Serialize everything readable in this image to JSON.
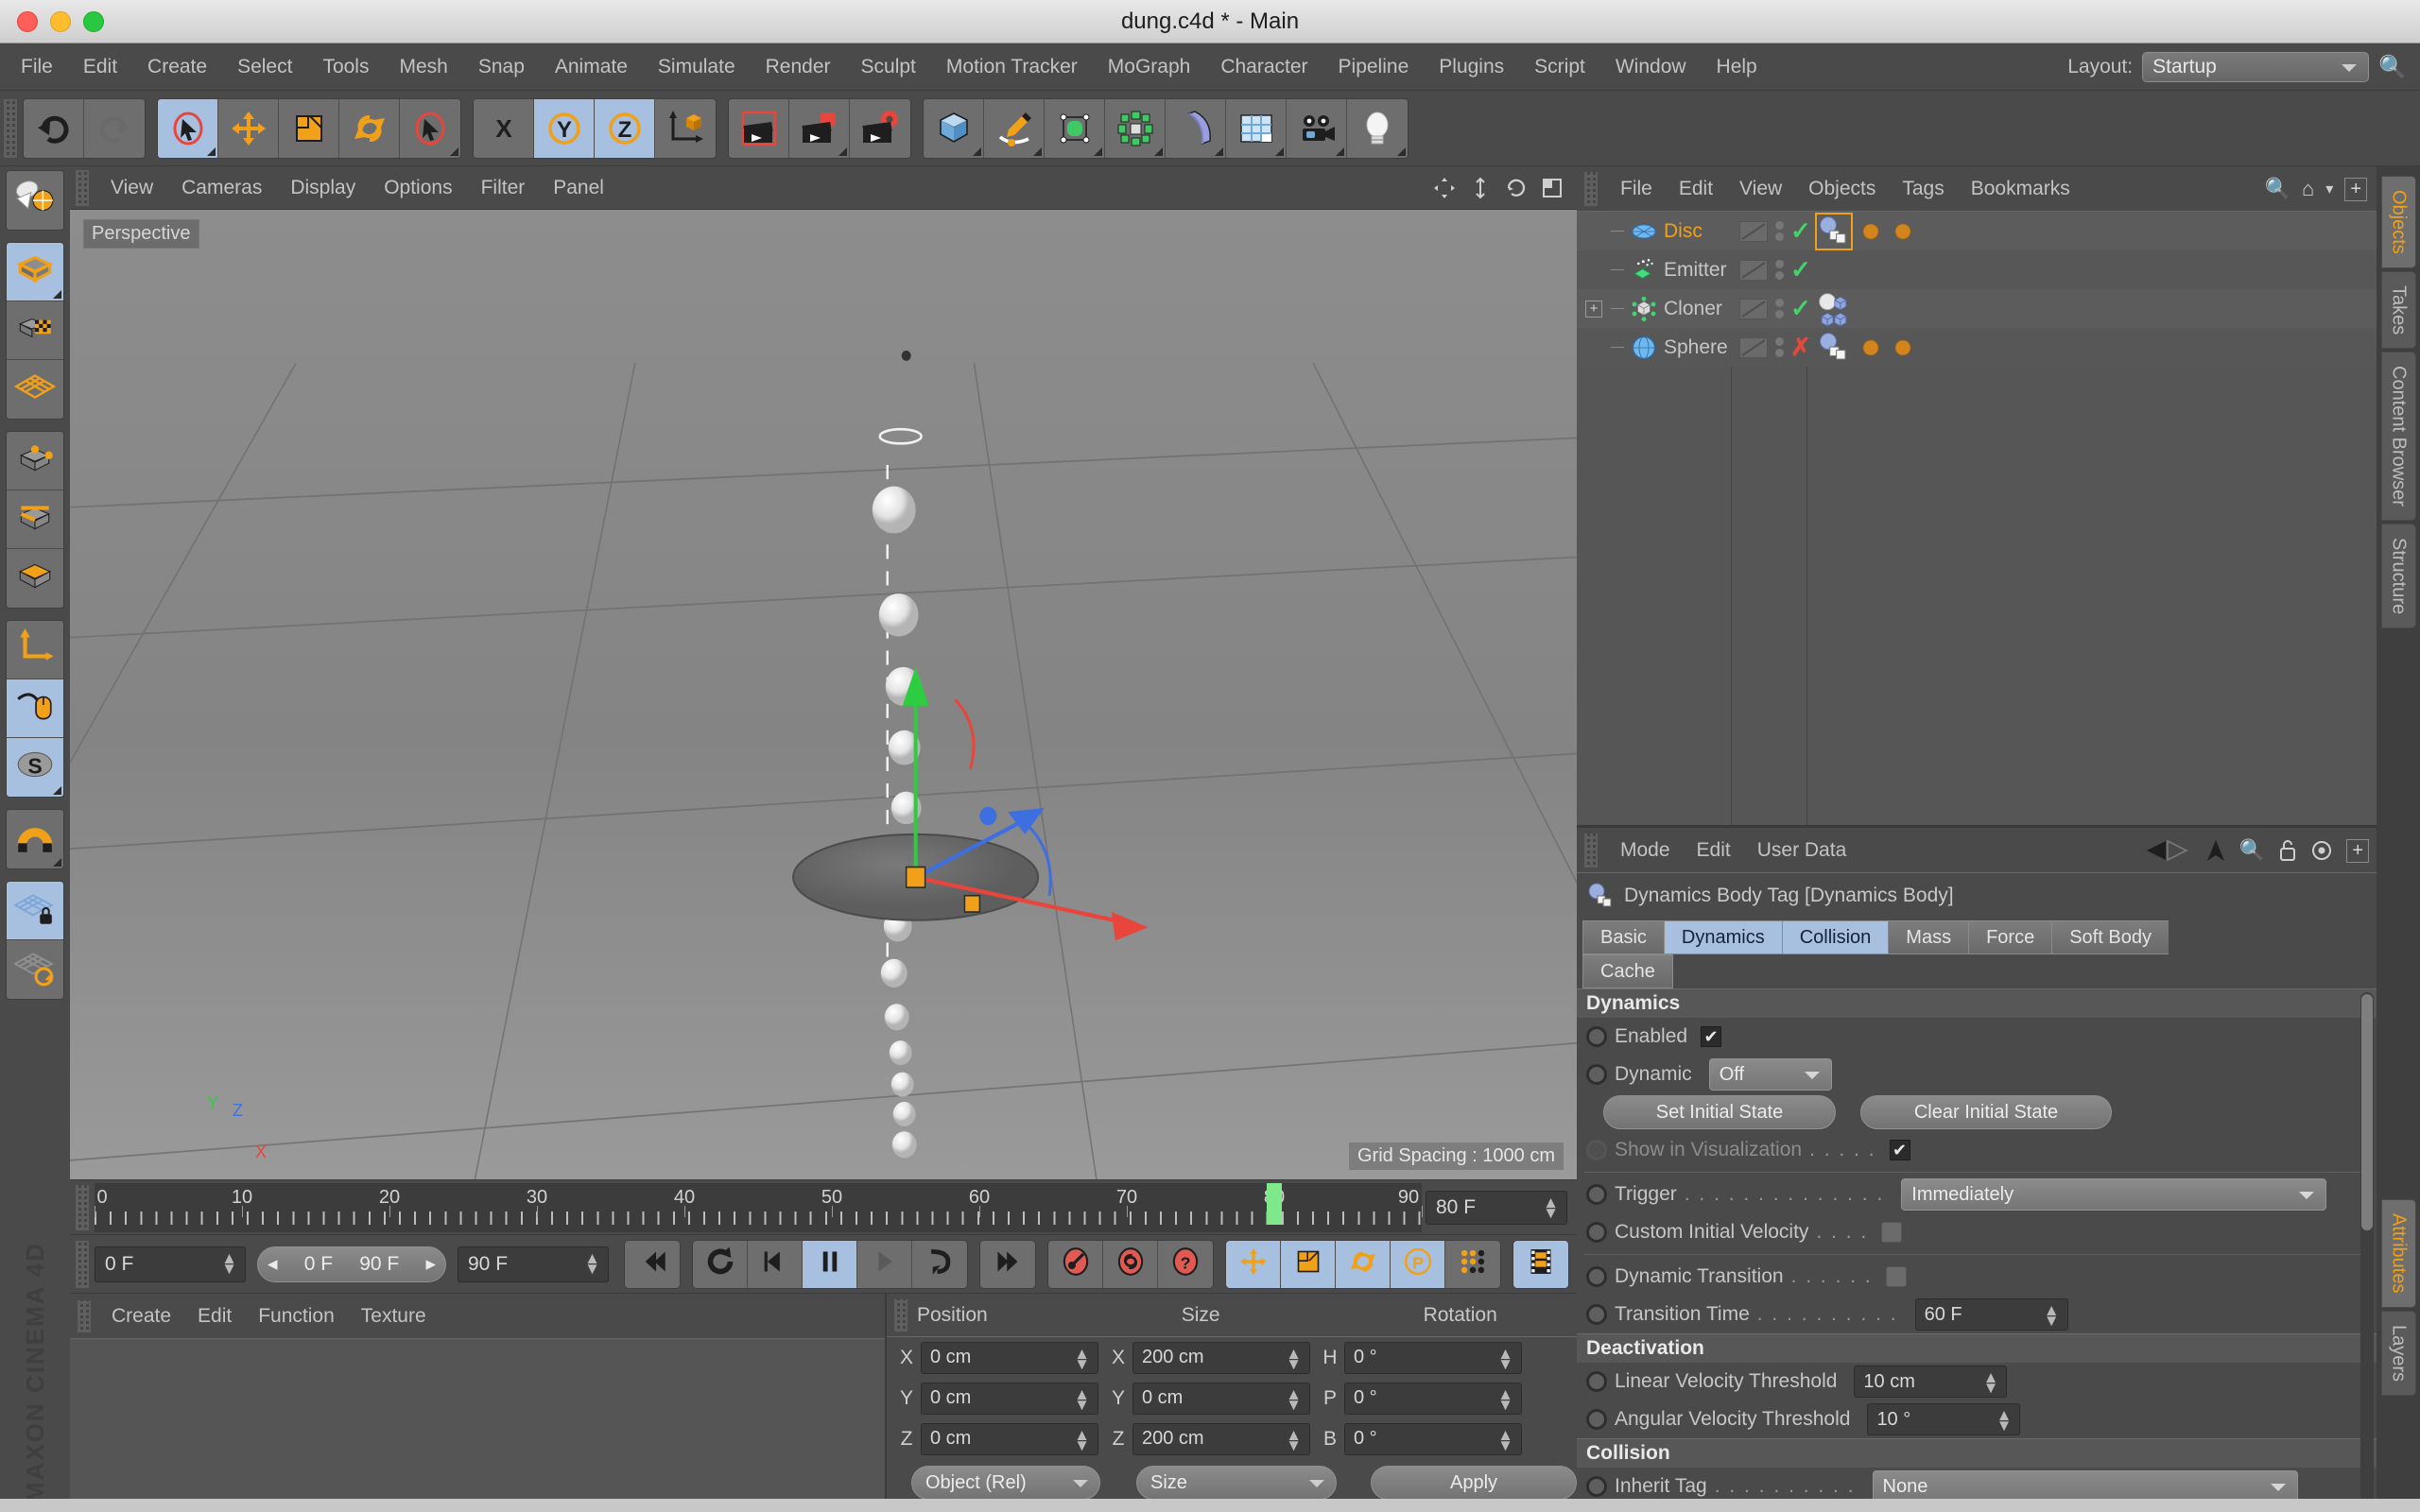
{
  "window": {
    "title": "dung.c4d * - Main"
  },
  "menubar": {
    "items": [
      "File",
      "Edit",
      "Create",
      "Select",
      "Tools",
      "Mesh",
      "Snap",
      "Animate",
      "Simulate",
      "Render",
      "Sculpt",
      "Motion Tracker",
      "MoGraph",
      "Character",
      "Pipeline",
      "Plugins",
      "Script",
      "Window",
      "Help"
    ],
    "layout_label": "Layout:",
    "layout_value": "Startup",
    "search_icon": "search-icon"
  },
  "toolbar": {
    "groups": [
      {
        "buttons": [
          {
            "icon": "undo-icon",
            "active": false,
            "corner": false
          },
          {
            "icon": "redo-icon",
            "active": false,
            "corner": false
          }
        ]
      },
      {
        "buttons": [
          {
            "icon": "live-selection-icon",
            "active": true,
            "corner": true
          },
          {
            "icon": "move-icon",
            "active": false,
            "corner": false
          },
          {
            "icon": "scale-icon",
            "active": false,
            "corner": false
          },
          {
            "icon": "rotate-icon",
            "active": false,
            "corner": false
          },
          {
            "icon": "selection-cursor-icon",
            "active": false,
            "corner": true
          }
        ]
      },
      {
        "buttons": [
          {
            "icon": "axis-x-icon",
            "active": false,
            "corner": false
          },
          {
            "icon": "axis-y-icon",
            "active": true,
            "corner": false
          },
          {
            "icon": "axis-z-icon",
            "active": true,
            "corner": false
          },
          {
            "icon": "world-object-axis-icon",
            "active": false,
            "corner": false
          }
        ]
      },
      {
        "buttons": [
          {
            "icon": "render-view-icon",
            "active": false,
            "corner": false
          },
          {
            "icon": "render-region-icon",
            "active": false,
            "corner": true
          },
          {
            "icon": "render-settings-icon",
            "active": false,
            "corner": false
          }
        ]
      },
      {
        "buttons": [
          {
            "icon": "cube-primitive-icon",
            "active": false,
            "corner": true
          },
          {
            "icon": "spline-pen-icon",
            "active": false,
            "corner": true
          },
          {
            "icon": "nurbs-generator-icon",
            "active": false,
            "corner": true
          },
          {
            "icon": "array-modeling-icon",
            "active": false,
            "corner": true
          },
          {
            "icon": "deformer-bend-icon",
            "active": false,
            "corner": true
          },
          {
            "icon": "scene-environment-icon",
            "active": false,
            "corner": true
          },
          {
            "icon": "camera-icon",
            "active": false,
            "corner": true
          },
          {
            "icon": "light-icon",
            "active": false,
            "corner": true
          }
        ]
      }
    ]
  },
  "lefttools": {
    "groups": [
      {
        "buttons": [
          {
            "icon": "undo-view-icon",
            "active": false,
            "corner": false
          }
        ]
      },
      {
        "buttons": [
          {
            "icon": "model-mode-icon",
            "active": true,
            "corner": true
          },
          {
            "icon": "texture-mode-icon",
            "active": false,
            "corner": false
          },
          {
            "icon": "workplane-mode-icon",
            "active": false,
            "corner": false
          }
        ]
      },
      {
        "buttons": [
          {
            "icon": "points-mode-icon",
            "active": false,
            "corner": false
          },
          {
            "icon": "edges-mode-icon",
            "active": false,
            "corner": false
          },
          {
            "icon": "polygons-mode-icon",
            "active": false,
            "corner": false
          }
        ]
      },
      {
        "buttons": [
          {
            "icon": "object-axis-icon",
            "active": false,
            "corner": false
          },
          {
            "icon": "enable-axis-icon",
            "active": true,
            "corner": false
          },
          {
            "icon": "soft-selection-icon",
            "active": true,
            "corner": true
          }
        ]
      },
      {
        "buttons": [
          {
            "icon": "snap-magnet-icon",
            "active": false,
            "corner": true
          }
        ]
      },
      {
        "buttons": [
          {
            "icon": "workplane-lock-icon",
            "active": true,
            "corner": false
          },
          {
            "icon": "workplane-align-icon",
            "active": false,
            "corner": false
          }
        ]
      }
    ],
    "brand": "MAXON CINEMA 4D"
  },
  "viewport": {
    "menus": [
      "View",
      "Cameras",
      "Display",
      "Options",
      "Filter",
      "Panel"
    ],
    "camera_label": "Perspective",
    "grid_spacing": "Grid Spacing : 1000 cm",
    "header_icons": [
      "pan-view-icon",
      "zoom-view-icon",
      "rotate-view-icon",
      "maximize-view-icon"
    ],
    "axis_gizmo_labels": [
      "Y",
      "Z",
      "X"
    ]
  },
  "timeline": {
    "tick_labels": [
      "0",
      "10",
      "20",
      "30",
      "40",
      "50",
      "60",
      "70",
      "80",
      "90"
    ],
    "playhead_frame": "80",
    "end_frame_field": "80 F"
  },
  "transport": {
    "current_frame": "0 F",
    "range_start": "0 F",
    "range_end": "90 F",
    "max_frame": "90 F",
    "buttons": [
      {
        "icon": "go-to-start-icon",
        "active": false
      },
      {
        "icon": "play-loop-icon",
        "active": false
      },
      {
        "icon": "step-back-icon",
        "active": false
      },
      {
        "icon": "pause-icon",
        "active": true
      },
      {
        "icon": "play-forward-icon",
        "active": false
      },
      {
        "icon": "next-key-icon",
        "active": false
      },
      {
        "icon": "go-to-end-icon",
        "active": false
      },
      {
        "icon": "record-key-icon",
        "active": false
      },
      {
        "icon": "autokey-icon",
        "active": false
      },
      {
        "icon": "keyframe-help-icon",
        "active": false
      },
      {
        "icon": "record-position-icon",
        "active": true
      },
      {
        "icon": "record-scale-icon",
        "active": true
      },
      {
        "icon": "record-rotation-icon",
        "active": true
      },
      {
        "icon": "record-param-icon",
        "active": true
      },
      {
        "icon": "record-pla-icon",
        "active": false
      },
      {
        "icon": "timeline-filmstrip-icon",
        "active": true
      }
    ]
  },
  "material_manager": {
    "menus": [
      "Create",
      "Edit",
      "Function",
      "Texture"
    ]
  },
  "coordinates": {
    "columns": [
      "Position",
      "Size",
      "Rotation"
    ],
    "rows": [
      {
        "pos_axis": "X",
        "pos_value": "0 cm",
        "size_axis": "X",
        "size_value": "200 cm",
        "rot_axis": "H",
        "rot_value": "0 °"
      },
      {
        "pos_axis": "Y",
        "pos_value": "0 cm",
        "size_axis": "Y",
        "size_value": "0 cm",
        "rot_axis": "P",
        "rot_value": "0 °"
      },
      {
        "pos_axis": "Z",
        "pos_value": "0 cm",
        "size_axis": "Z",
        "size_value": "200 cm",
        "rot_axis": "B",
        "rot_value": "0 °"
      }
    ],
    "mode_value": "Object (Rel)",
    "size_mode_value": "Size",
    "apply_label": "Apply"
  },
  "object_manager": {
    "menus": [
      "File",
      "Edit",
      "View",
      "Objects",
      "Tags",
      "Bookmarks"
    ],
    "head_icons": [
      "search-icon",
      "home-icon",
      "chevron-down-icon",
      "add-panel-icon"
    ],
    "rows": [
      {
        "name": "Disc",
        "icon": "disc-object-icon",
        "selected": true,
        "visible_dot": "gray",
        "enabled": "check",
        "tags": [
          "dynamics-body-tag",
          "material-tag",
          "material-tag"
        ],
        "tag_selected": true,
        "expander": false
      },
      {
        "name": "Emitter",
        "icon": "emitter-object-icon",
        "selected": false,
        "visible_dot": "gray",
        "enabled": "check",
        "tags": [],
        "tag_selected": false,
        "expander": false
      },
      {
        "name": "Cloner",
        "icon": "cloner-object-icon",
        "selected": false,
        "visible_dot": "gray",
        "enabled": "check",
        "tags": [
          "mograph-cloner-tag"
        ],
        "tag_selected": false,
        "expander": true
      },
      {
        "name": "Sphere",
        "icon": "sphere-object-icon",
        "selected": false,
        "visible_dot": "gray",
        "enabled": "cross",
        "tags": [
          "dynamics-body-tag",
          "material-tag",
          "material-tag"
        ],
        "tag_selected": false,
        "expander": false
      }
    ]
  },
  "attribute_manager": {
    "menus": [
      "Mode",
      "Edit",
      "User Data"
    ],
    "head_icons": [
      "nav-back-icon",
      "nav-forward-icon",
      "pin-icon",
      "search-icon",
      "lock-icon",
      "target-icon",
      "add-panel-icon"
    ],
    "title": "Dynamics Body Tag [Dynamics Body]",
    "title_icon": "dynamics-body-tag-icon",
    "tabs": [
      {
        "label": "Basic",
        "selected": false
      },
      {
        "label": "Dynamics",
        "selected": true
      },
      {
        "label": "Collision",
        "selected": true
      },
      {
        "label": "Mass",
        "selected": false
      },
      {
        "label": "Force",
        "selected": false
      },
      {
        "label": "Soft Body",
        "selected": false
      },
      {
        "label": "Cache",
        "selected": false
      }
    ],
    "sections": [
      {
        "title": "Dynamics",
        "rows": [
          {
            "type": "checkbox",
            "label": "Enabled",
            "dots": "",
            "checked": true,
            "dim": false
          },
          {
            "type": "dropdown",
            "label": "Dynamic",
            "dots": "",
            "value": "Off",
            "dim": false
          },
          {
            "type": "buttons",
            "labels": [
              "Set Initial State",
              "Clear Initial State"
            ]
          },
          {
            "type": "checkbox",
            "label": "Show in Visualization",
            "dots": ". . . . .",
            "checked": true,
            "dim": true
          }
        ]
      },
      {
        "title": "",
        "rows": [
          {
            "type": "dropdown-wide",
            "label": "Trigger",
            "dots": ". . . . . . . . . . . . . .",
            "value": "Immediately",
            "dim": false
          },
          {
            "type": "toggle",
            "label": "Custom Initial Velocity",
            "dots": ". . . .",
            "checked": false,
            "dim": false
          }
        ]
      },
      {
        "title": "",
        "rows": [
          {
            "type": "toggle",
            "label": "Dynamic Transition",
            "dots": ". . . . . .",
            "checked": false,
            "dim": false
          },
          {
            "type": "number",
            "label": "Transition Time",
            "dots": ". . . . . . . . . .",
            "value": "60 F",
            "dim": false
          }
        ]
      },
      {
        "title": "Deactivation",
        "rows": [
          {
            "type": "number",
            "label": "Linear Velocity Threshold",
            "dots": "",
            "value": "10 cm",
            "dim": false
          },
          {
            "type": "number",
            "label": "Angular Velocity Threshold",
            "dots": "",
            "value": "10 °",
            "dim": false
          }
        ]
      },
      {
        "title": "Collision",
        "rows": [
          {
            "type": "dropdown-wide",
            "label": "Inherit Tag",
            "dots": ". . . . . . . . . .",
            "value": "None",
            "dim": false
          }
        ]
      }
    ]
  },
  "vertical_tabs": {
    "top": [
      {
        "label": "Objects",
        "selected": true
      },
      {
        "label": "Takes",
        "selected": false
      },
      {
        "label": "Content Browser",
        "selected": false
      },
      {
        "label": "Structure",
        "selected": false
      }
    ],
    "bottom": [
      {
        "label": "Attributes",
        "selected": true
      },
      {
        "label": "Layers",
        "selected": false
      }
    ]
  },
  "colors": {
    "accent_orange": "#f0a019",
    "selection_blue": "#a8c0e0",
    "panel_bg": "#4a4a4a",
    "field_bg": "#3c3c3c",
    "green_check": "#45d26a",
    "red_cross": "#e04a3c",
    "playhead_green": "#7ee88a"
  }
}
